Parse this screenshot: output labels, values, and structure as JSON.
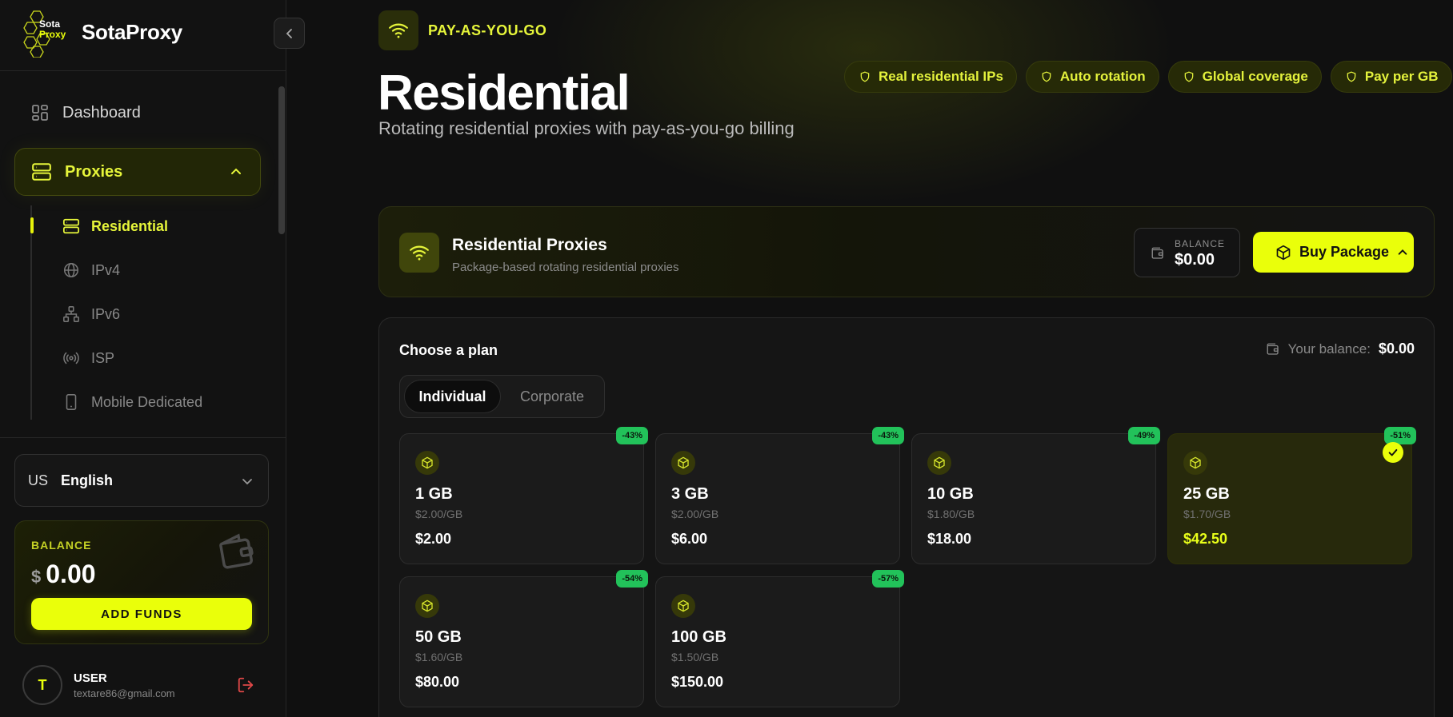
{
  "brand": {
    "name": "SotaProxy",
    "logo_top": "Sota",
    "logo_bottom": "Proxy"
  },
  "sidebar": {
    "dashboard": "Dashboard",
    "proxies": "Proxies",
    "sub_items": [
      "Residential",
      "IPv4",
      "IPv6",
      "ISP",
      "Mobile Dedicated"
    ],
    "language": {
      "code": "US",
      "name": "English"
    },
    "balance": {
      "label": "BALANCE",
      "currency": "$",
      "value": "0.00",
      "button": "ADD FUNDS"
    },
    "user": {
      "name": "USER",
      "email": "textare86@gmail.com",
      "initial": "T"
    }
  },
  "header": {
    "badge": "PAY-AS-YOU-GO",
    "title": "Residential",
    "subtitle": "Rotating residential proxies with pay-as-you-go billing",
    "features": [
      "Real residential IPs",
      "Auto rotation",
      "Global coverage",
      "Pay per GB"
    ]
  },
  "product": {
    "title": "Residential Proxies",
    "subtitle": "Package-based rotating residential proxies",
    "balance_label": "BALANCE",
    "balance_value": "$0.00",
    "buy_label": "Buy Package"
  },
  "plans": {
    "title": "Choose a plan",
    "your_balance_label": "Your balance:",
    "your_balance_value": "$0.00",
    "tabs": [
      "Individual",
      "Corporate"
    ],
    "packages": [
      {
        "size": "1 GB",
        "per": "$2.00/GB",
        "price": "$2.00",
        "discount": "-43%"
      },
      {
        "size": "3 GB",
        "per": "$2.00/GB",
        "price": "$6.00",
        "discount": "-43%"
      },
      {
        "size": "10 GB",
        "per": "$1.80/GB",
        "price": "$18.00",
        "discount": "-49%"
      },
      {
        "size": "25 GB",
        "per": "$1.70/GB",
        "price": "$42.50",
        "discount": "-51%"
      },
      {
        "size": "50 GB",
        "per": "$1.60/GB",
        "price": "$80.00",
        "discount": "-54%"
      },
      {
        "size": "100 GB",
        "per": "$1.50/GB",
        "price": "$150.00",
        "discount": "-57%"
      }
    ]
  },
  "colors": {
    "accent": "#eaff0a",
    "discount": "#22c25a",
    "background": "#101010"
  }
}
